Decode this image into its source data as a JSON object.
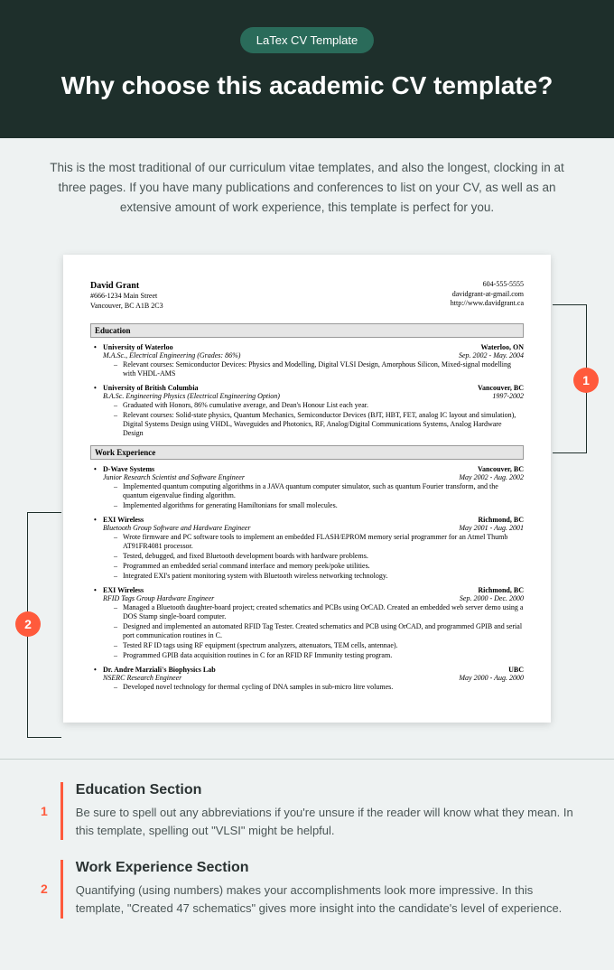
{
  "header": {
    "badge": "LaTex CV Template",
    "title": "Why choose this academic CV template?"
  },
  "intro": "This is the most traditional of our curriculum vitae templates, and also the longest, clocking in at three pages. If you have many publications and conferences to list on your CV, as well as an extensive amount of work experience, this template is perfect for you.",
  "cv": {
    "name": "David Grant",
    "addr1": "#666-1234 Main Street",
    "addr2": "Vancouver, BC A1B 2C3",
    "phone": "604-555-5555",
    "email": "davidgrant-at-gmail.com",
    "web": "http://www.davidgrant.ca",
    "sec_education": "Education",
    "sec_work": "Work Experience",
    "edu1": {
      "school": "University of Waterloo",
      "loc": "Waterloo, ON",
      "degree": "M.A.Sc., Electrical Engineering (Grades: 86%)",
      "date": "Sep. 2002 - May. 2004",
      "b1": "Relevant courses: Semiconductor Devices: Physics and Modelling, Digital VLSI Design, Amorphous Silicon, Mixed-signal modelling with VHDL-AMS"
    },
    "edu2": {
      "school": "University of British Columbia",
      "loc": "Vancouver, BC",
      "degree": "B.A.Sc. Engineering Physics (Electrical Engineering Option)",
      "date": "1997-2002",
      "b1": "Graduated with Honors, 86% cumulative average, and Dean's Honour List each year.",
      "b2": "Relevant courses: Solid-state physics, Quantum Mechanics, Semiconductor Devices (BJT, HBT, FET, analog IC layout and simulation), Digital Systems Design using VHDL, Waveguides and Photonics, RF, Analog/Digital Communications Systems, Analog Hardware Design"
    },
    "w1": {
      "org": "D-Wave Systems",
      "loc": "Vancouver, BC",
      "role": "Junior Research Scientist and Software Engineer",
      "date": "May 2002 - Aug. 2002",
      "b1": "Implemented quantum computing algorithms in a JAVA quantum computer simulator, such as quantum Fourier transform, and the quantum eigenvalue finding algorithm.",
      "b2": "Implemented algorithms for generating Hamiltonians for small molecules."
    },
    "w2": {
      "org": "EXI Wireless",
      "loc": "Richmond, BC",
      "role": "Bluetooth Group Software and Hardware Engineer",
      "date": "May 2001 - Aug. 2001",
      "b1": "Wrote firmware and PC software tools to implement an embedded FLASH/EPROM memory serial programmer for an Atmel Thumb AT91FR4081 processor.",
      "b2": "Tested, debugged, and fixed Bluetooth development boards with hardware problems.",
      "b3": "Programmed an embedded serial command interface and memory peek/poke utilities.",
      "b4": "Integrated EXI's patient monitoring system with Bluetooth wireless networking technology."
    },
    "w3": {
      "org": "EXI Wireless",
      "loc": "Richmond, BC",
      "role": "RFID Tags Group Hardware Engineer",
      "date": "Sep. 2000 - Dec. 2000",
      "b1": "Managed a Bluetooth daughter-board project; created schematics and PCBs using OrCAD. Created an embedded web server demo using a DOS Stamp single-board computer.",
      "b2": "Designed and implemented an automated RFID Tag Tester. Created schematics and PCB using OrCAD, and programmed GPIB and serial port communication routines in C.",
      "b3": "Tested RF ID tags using RF equipment (spectrum analyzers, attenuators, TEM cells, antennae).",
      "b4": "Programmed GPIB data acquisition routines in C for an RFID RF Immunity testing program."
    },
    "w4": {
      "org": "Dr. Andre Marziali's Biophysics Lab",
      "loc": "UBC",
      "role": "NSERC Research Engineer",
      "date": "May 2000 - Aug. 2000",
      "b1": "Developed novel technology for thermal cycling of DNA samples in sub-micro litre volumes."
    }
  },
  "markers": {
    "m1": "1",
    "m2": "2"
  },
  "notes": {
    "n1": {
      "num": "1",
      "title": "Education Section",
      "text": "Be sure to spell out any abbreviations if you're unsure if the reader will know what they mean. In this template, spelling out \"VLSI\" might be helpful."
    },
    "n2": {
      "num": "2",
      "title": "Work Experience Section",
      "text": "Quantifying (using numbers) makes your accomplishments look more impressive. In this template, \"Created 47 schematics\" gives more insight into the candidate's level of experience."
    }
  }
}
